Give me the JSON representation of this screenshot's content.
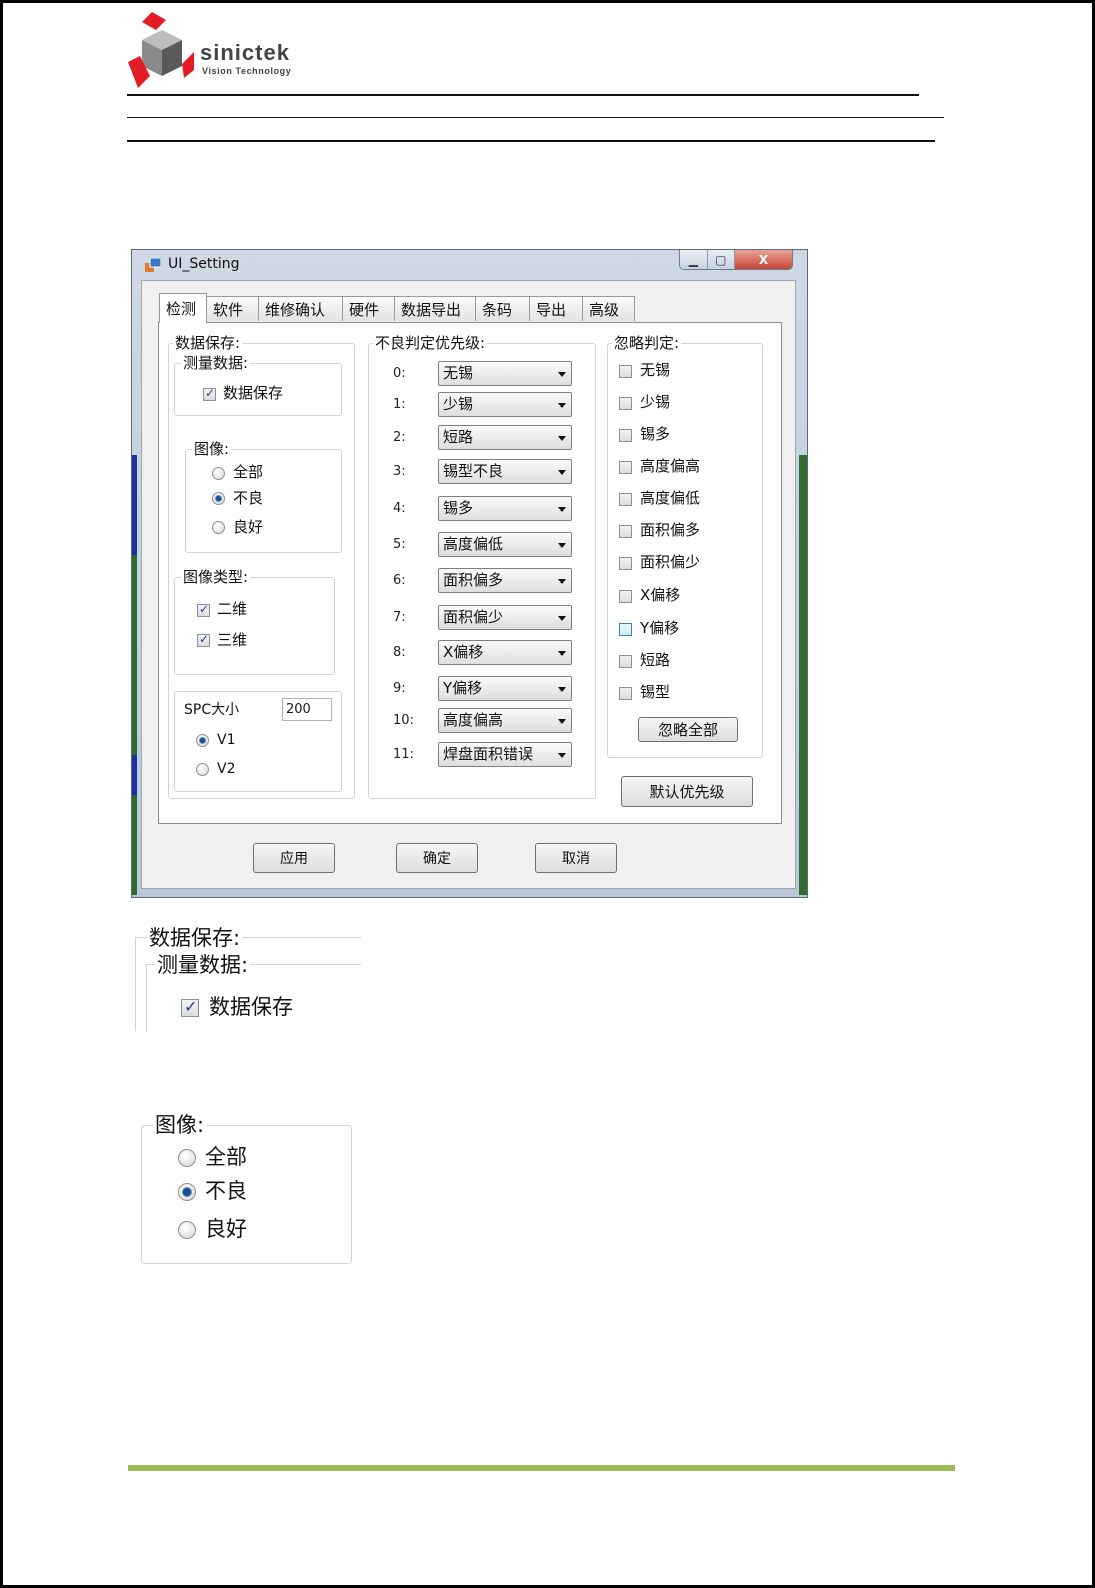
{
  "logo": {
    "name": "sinictek",
    "tagline": "Vision Technology"
  },
  "window": {
    "title": "UI_Setting",
    "controls": {
      "minimize": "▁",
      "maximize": "▢",
      "close": "X"
    },
    "tabs": [
      "检测",
      "软件",
      "维修确认",
      "硬件",
      "数据导出",
      "条码",
      "导出",
      "高级"
    ],
    "active_tab": "检测",
    "data_save": {
      "title": "数据保存:",
      "measure": {
        "title": "测量数据:",
        "checkbox": {
          "label": "数据保存",
          "checked": true
        }
      },
      "image": {
        "title": "图像:",
        "options": [
          {
            "label": "全部",
            "checked": false
          },
          {
            "label": "不良",
            "checked": true
          },
          {
            "label": "良好",
            "checked": false
          }
        ]
      },
      "image_type": {
        "title": "图像类型:",
        "options": [
          {
            "label": "二维",
            "checked": true
          },
          {
            "label": "三维",
            "checked": true
          }
        ]
      },
      "spc": {
        "label": "SPC大小",
        "value": "200",
        "options": [
          {
            "label": "V1",
            "checked": true
          },
          {
            "label": "V2",
            "checked": false
          }
        ]
      }
    },
    "priority": {
      "title": "不良判定优先级:",
      "items": [
        {
          "num": "0:",
          "value": "无锡"
        },
        {
          "num": "1:",
          "value": "少锡"
        },
        {
          "num": "2:",
          "value": "短路"
        },
        {
          "num": "3:",
          "value": "锡型不良"
        },
        {
          "num": "4:",
          "value": "锡多"
        },
        {
          "num": "5:",
          "value": "高度偏低"
        },
        {
          "num": "6:",
          "value": "面积偏多"
        },
        {
          "num": "7:",
          "value": "面积偏少"
        },
        {
          "num": "8:",
          "value": "X偏移"
        },
        {
          "num": "9:",
          "value": "Y偏移"
        },
        {
          "num": "10:",
          "value": "高度偏高"
        },
        {
          "num": "11:",
          "value": "焊盘面积错误"
        }
      ]
    },
    "ignore": {
      "title": "忽略判定:",
      "items": [
        "无锡",
        "少锡",
        "锡多",
        "高度偏高",
        "高度偏低",
        "面积偏多",
        "面积偏少",
        "X偏移",
        "Y偏移",
        "短路",
        "锡型"
      ],
      "ignore_all_label": "忽略全部"
    },
    "default_priority_label": "默认优先级",
    "footer_buttons": {
      "apply": "应用",
      "ok": "确定",
      "cancel": "取消"
    }
  },
  "zoom_data_save": {
    "title": "数据保存:",
    "sub_title": "测量数据:",
    "checkbox_label": "数据保存"
  },
  "zoom_image": {
    "title": "图像:",
    "options": [
      "全部",
      "不良",
      "良好"
    ],
    "selected": "不良"
  },
  "colors": {
    "accent_rule": "#9bbb59",
    "window_frame": "#b9c7d8"
  }
}
